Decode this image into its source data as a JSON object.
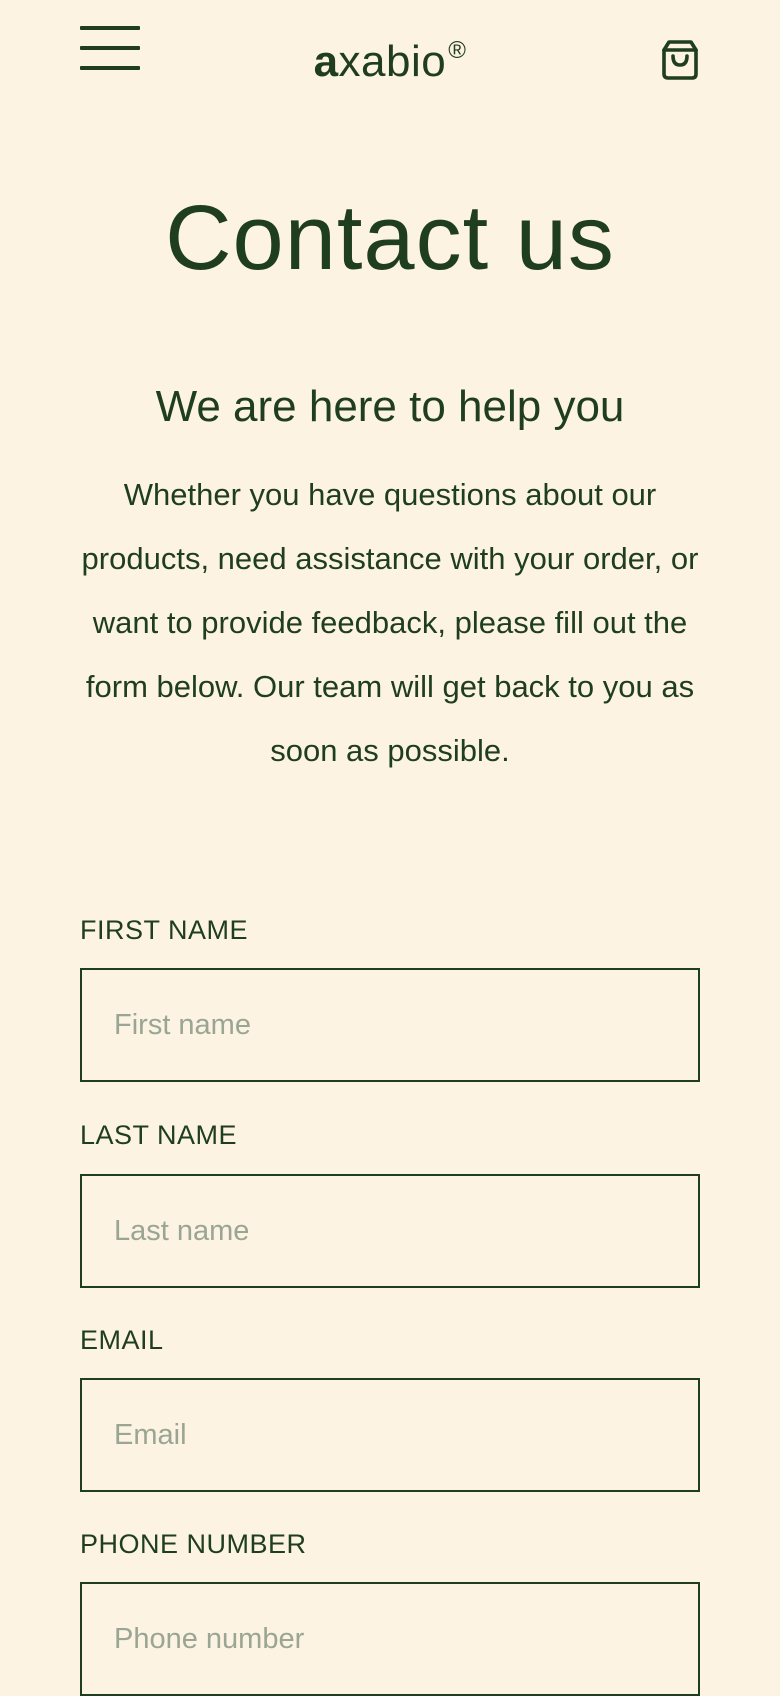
{
  "header": {
    "brand_lead": "a",
    "brand_rest": "xabio",
    "brand_mark": "®",
    "menu_icon": "hamburger-menu-icon",
    "cart_icon": "shopping-bag-icon"
  },
  "hero": {
    "title": "Contact us",
    "subtitle": "We are here to help you",
    "intro": "Whether you have questions about our products, need assistance with your order, or want to provide feedback, please fill out the form below. Our team will get back to you as soon as possible."
  },
  "form": {
    "first_name": {
      "label": "FIRST NAME",
      "placeholder": "First name",
      "value": ""
    },
    "last_name": {
      "label": "LAST NAME",
      "placeholder": "Last name",
      "value": ""
    },
    "email": {
      "label": "EMAIL",
      "placeholder": "Email",
      "value": ""
    },
    "phone": {
      "label": "PHONE NUMBER",
      "placeholder": "Phone number",
      "value": ""
    }
  },
  "colors": {
    "background": "#fcf3e3",
    "primary": "#1f3d1f",
    "placeholder": "#9aa593"
  }
}
